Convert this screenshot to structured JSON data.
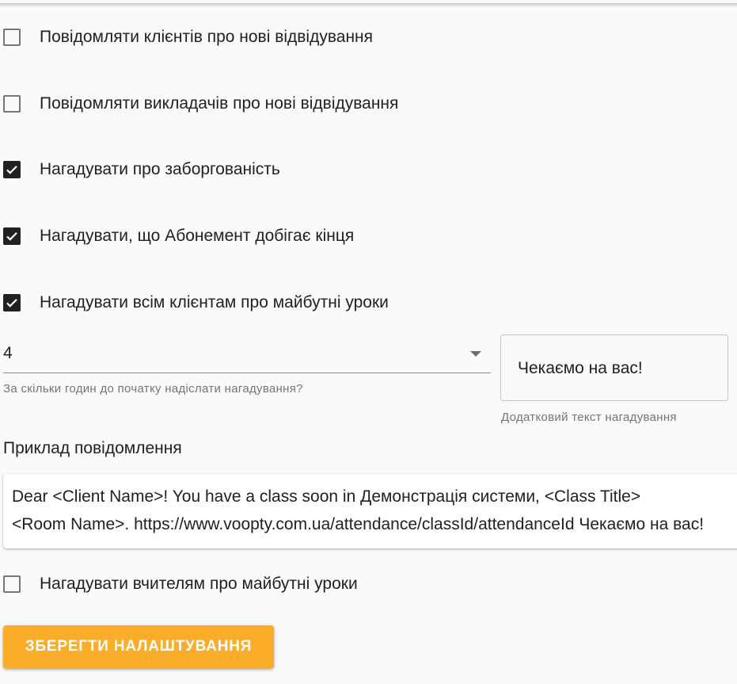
{
  "notifications": {
    "notify_clients_new_visits": {
      "label": "Повідомляти клієнтів про нові відвідування",
      "checked": false
    },
    "notify_teachers_new_visits": {
      "label": "Повідомляти викладачів про нові відвідування",
      "checked": false
    },
    "remind_debt": {
      "label": "Нагадувати про заборгованість",
      "checked": true
    },
    "remind_subscription_ending": {
      "label": "Нагадувати, що Абонемент добігає кінця",
      "checked": true
    },
    "remind_clients_upcoming": {
      "label": "Нагадувати всім клієнтам про майбутні уроки",
      "checked": true
    },
    "remind_teachers_upcoming": {
      "label": "Нагадувати вчителям про майбутні уроки",
      "checked": false
    }
  },
  "reminder": {
    "hours_value": "4",
    "hours_help": "За скільки годин до початку надіслати нагадування?",
    "extra_text_value": "Чекаємо на вас!",
    "extra_text_help": "Додатковий текст нагадування"
  },
  "example": {
    "title": "Приклад повідомлення",
    "line1": "Dear <Client Name>! You have a class soon in Демонстрація системи, <Class Title>",
    "line2": "<Room Name>. https://www.voopty.com.ua/attendance/classId/attendanceId Чекаємо на вас!"
  },
  "actions": {
    "save_label": "ЗБЕРЕГТИ НАЛАШТУВАННЯ"
  },
  "colors": {
    "accent": "#f9ad2b",
    "checkbox_checked": "#212121"
  }
}
